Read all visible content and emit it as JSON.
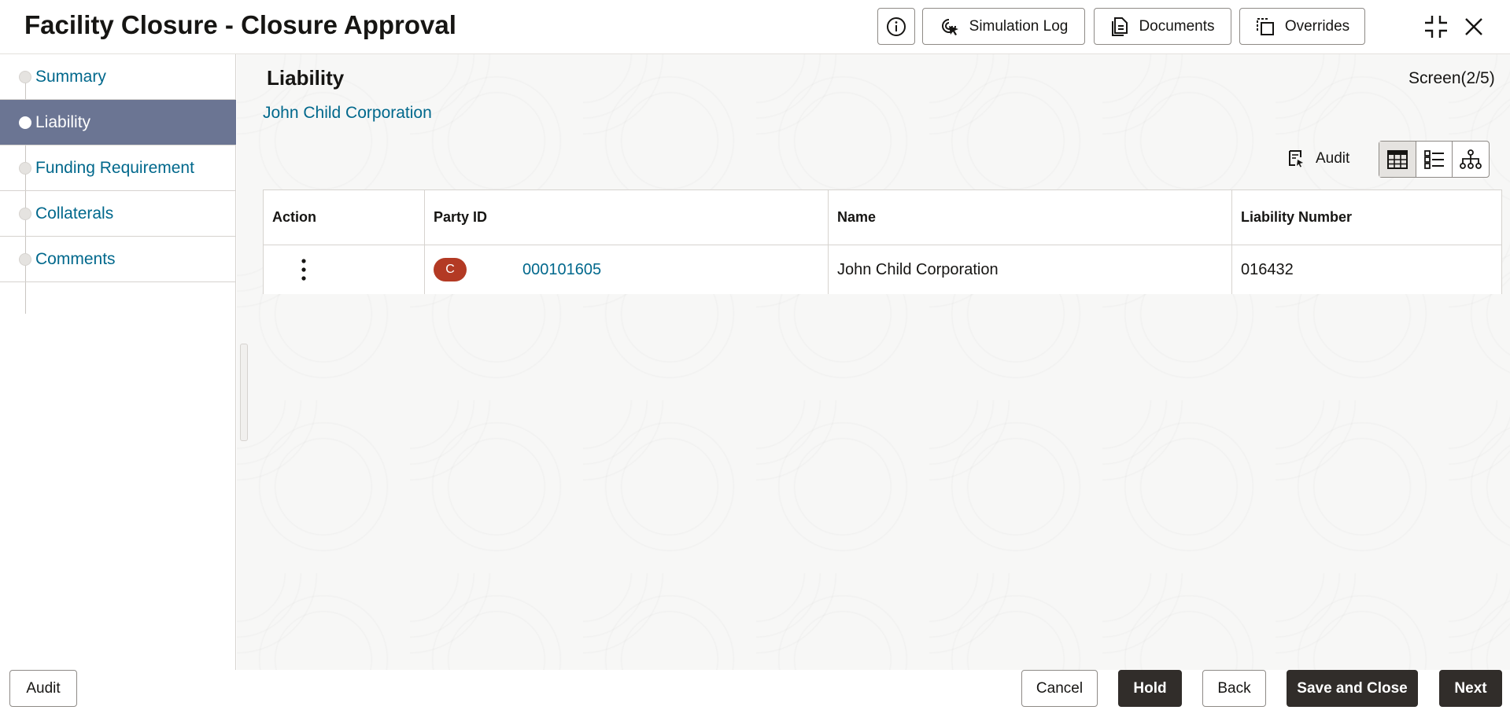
{
  "header": {
    "title": "Facility Closure - Closure Approval",
    "buttons": {
      "info_icon": "info-icon",
      "simulation_log": "Simulation Log",
      "documents": "Documents",
      "overrides": "Overrides"
    }
  },
  "sidebar": {
    "items": [
      {
        "label": "Summary",
        "active": false
      },
      {
        "label": "Liability",
        "active": true
      },
      {
        "label": "Funding Requirement",
        "active": false
      },
      {
        "label": "Collaterals",
        "active": false
      },
      {
        "label": "Comments",
        "active": false
      }
    ]
  },
  "main": {
    "section_title": "Liability",
    "screen_counter": "Screen(2/5)",
    "customer_name": "John Child Corporation",
    "audit_label": "Audit",
    "view_modes": [
      "table-view",
      "list-view",
      "tree-view"
    ],
    "table": {
      "headers": [
        "Action",
        "Party ID",
        "Name",
        "Liability Number"
      ],
      "rows": [
        {
          "badge": "C",
          "party_id": "000101605",
          "name": "John Child Corporation",
          "liability_number": "016432"
        }
      ]
    }
  },
  "footer": {
    "audit": "Audit",
    "cancel": "Cancel",
    "hold": "Hold",
    "back": "Back",
    "save_and_close": "Save and Close",
    "next": "Next"
  },
  "colors": {
    "accent_link": "#00688c",
    "active_nav": "#6b7593",
    "badge": "#b33a24",
    "dark_button": "#312d2a"
  }
}
